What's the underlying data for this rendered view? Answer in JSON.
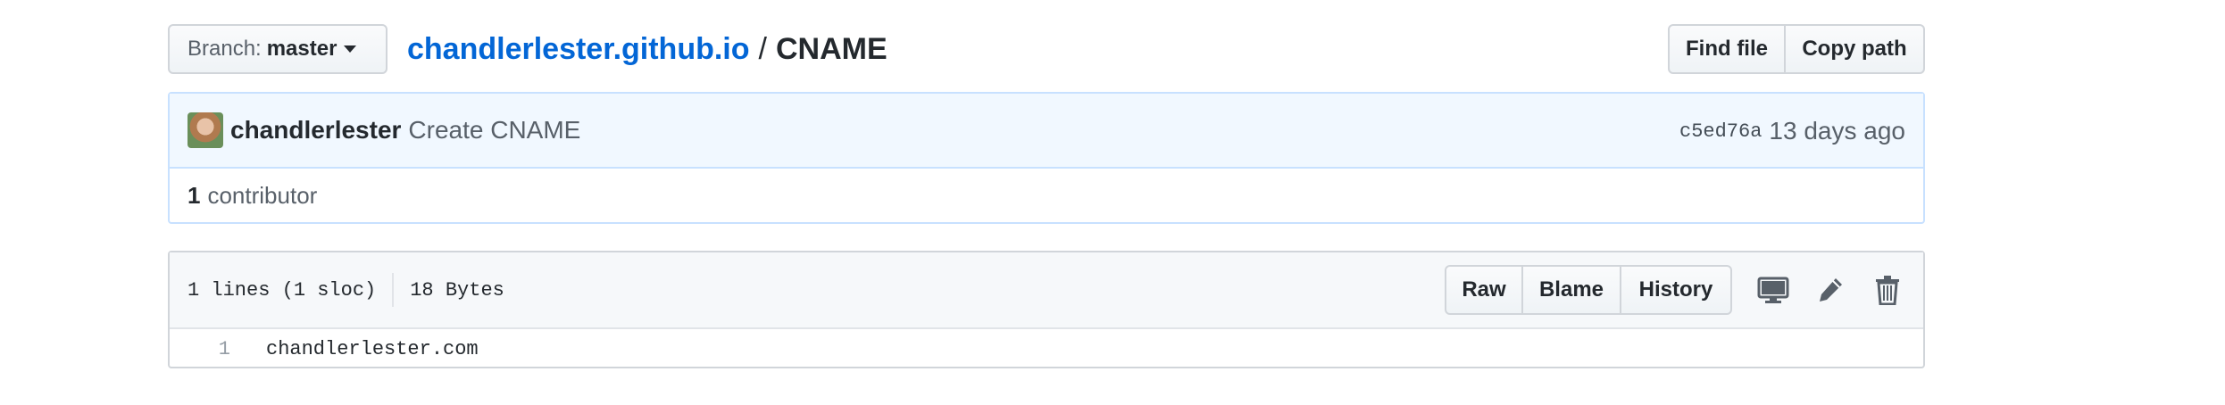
{
  "branch": {
    "label": "Branch:",
    "value": "master"
  },
  "breadcrumb": {
    "repo": "chandlerlester.github.io",
    "separator": "/",
    "file": "CNAME"
  },
  "top_actions": {
    "find_file": "Find file",
    "copy_path": "Copy path"
  },
  "commit": {
    "author": "chandlerlester",
    "message": "Create CNAME",
    "sha": "c5ed76a",
    "ago": "13 days ago"
  },
  "contributors": {
    "count": "1",
    "label": "contributor"
  },
  "file": {
    "lines": "1 lines (1 sloc)",
    "size": "18 Bytes",
    "actions": {
      "raw": "Raw",
      "blame": "Blame",
      "history": "History"
    },
    "icons": [
      "desktop-icon",
      "pencil-icon",
      "trashcan-icon"
    ],
    "code_lines": [
      {
        "number": "1",
        "text": "chandlerlester.com"
      }
    ]
  },
  "colors": {
    "link": "#0366d6",
    "commit_bg": "#f1f8ff",
    "commit_border": "#c8e1ff"
  }
}
